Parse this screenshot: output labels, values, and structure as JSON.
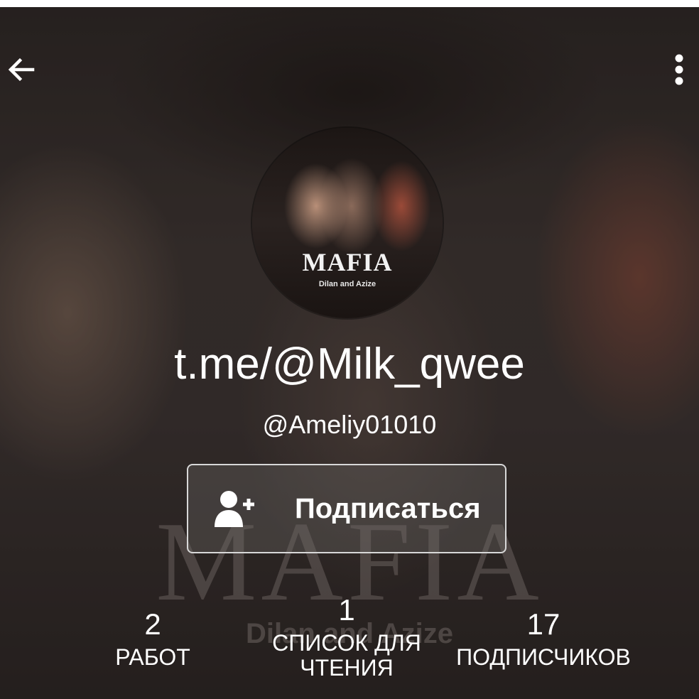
{
  "background": {
    "title": "MAFIA",
    "subtitle": "Dilan and Azize"
  },
  "toolbar": {
    "back_icon": "arrow-left-icon",
    "menu_icon": "more-vertical-icon"
  },
  "avatar": {
    "title": "MAFIA",
    "subtitle": "Dilan and Azize"
  },
  "profile": {
    "display_name": "t.me/@Milk_qwee",
    "username": "@Ameliy01010"
  },
  "follow_button": {
    "label": "Подписаться",
    "icon": "add-user-icon"
  },
  "stats": {
    "works": {
      "value": "2",
      "label": "РАБОТ"
    },
    "reading_lists": {
      "value": "1",
      "label": "СПИСОК ДЛЯ ЧТЕНИЯ"
    },
    "followers": {
      "value": "17",
      "label": "ПОДПИСЧИКОВ"
    }
  },
  "colors": {
    "text": "#ffffff",
    "button_border": "#d8d8d8",
    "background_dark": "#2c2624"
  }
}
